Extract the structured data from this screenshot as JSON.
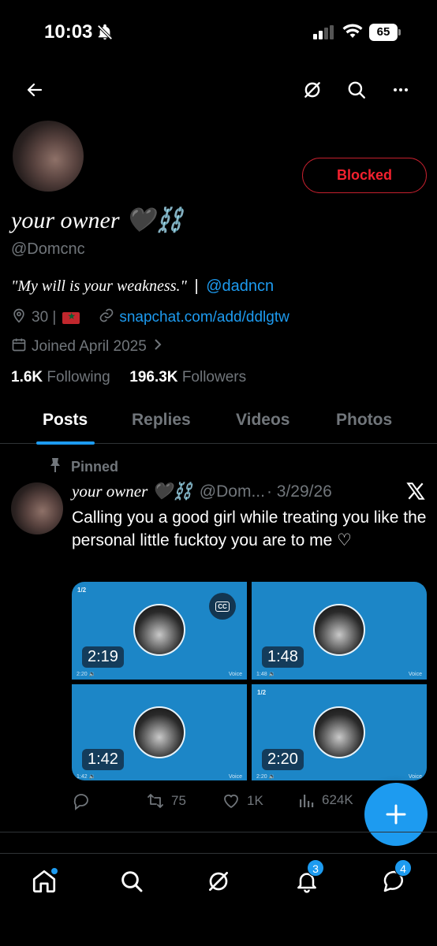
{
  "status_bar": {
    "time": "10:03",
    "battery": "65"
  },
  "profile": {
    "display_name": "your owner 🖤⛓️",
    "handle": "@Domcnc",
    "blocked_label": "Blocked",
    "bio_quote": "\"My will is your weakness.\"",
    "bio_sep": "|",
    "bio_link": "@dadncn",
    "location": "30 |",
    "url": "snapchat.com/add/ddlgtw",
    "joined": "Joined April 2025",
    "following_count": "1.6K",
    "following_label": "Following",
    "followers_count": "196.3K",
    "followers_label": "Followers"
  },
  "tabs": [
    {
      "label": "Posts",
      "active": true
    },
    {
      "label": "Replies",
      "active": false
    },
    {
      "label": "Videos",
      "active": false
    },
    {
      "label": "Photos",
      "active": false
    }
  ],
  "post": {
    "pinned_label": "Pinned",
    "author": "your owner 🖤⛓️",
    "handle": "@Dom...",
    "date": "· 3/29/26",
    "text": "Calling you a good girl while treating you like the personal little fucktoy you are to me ♡",
    "media": [
      {
        "duration": "2:19",
        "index": "1/2",
        "small": "2:20 🔉",
        "voice": "Voice",
        "cc": "CC"
      },
      {
        "duration": "1:48",
        "index": "",
        "small": "1:48 🔉",
        "voice": "Voice"
      },
      {
        "duration": "1:42",
        "index": "",
        "small": "1:42 🔉",
        "voice": "Voice"
      },
      {
        "duration": "2:20",
        "index": "1/2",
        "small": "2:20 🔉",
        "voice": "Voice"
      }
    ],
    "retweets": "75",
    "likes": "1K",
    "views": "624K"
  },
  "bottom_nav": {
    "notifications_badge": "3",
    "messages_badge": "4"
  },
  "colors": {
    "accent": "#1d9bf0",
    "blocked": "#f4212e",
    "muted": "#71767b",
    "media_bg": "#1c86c7"
  }
}
